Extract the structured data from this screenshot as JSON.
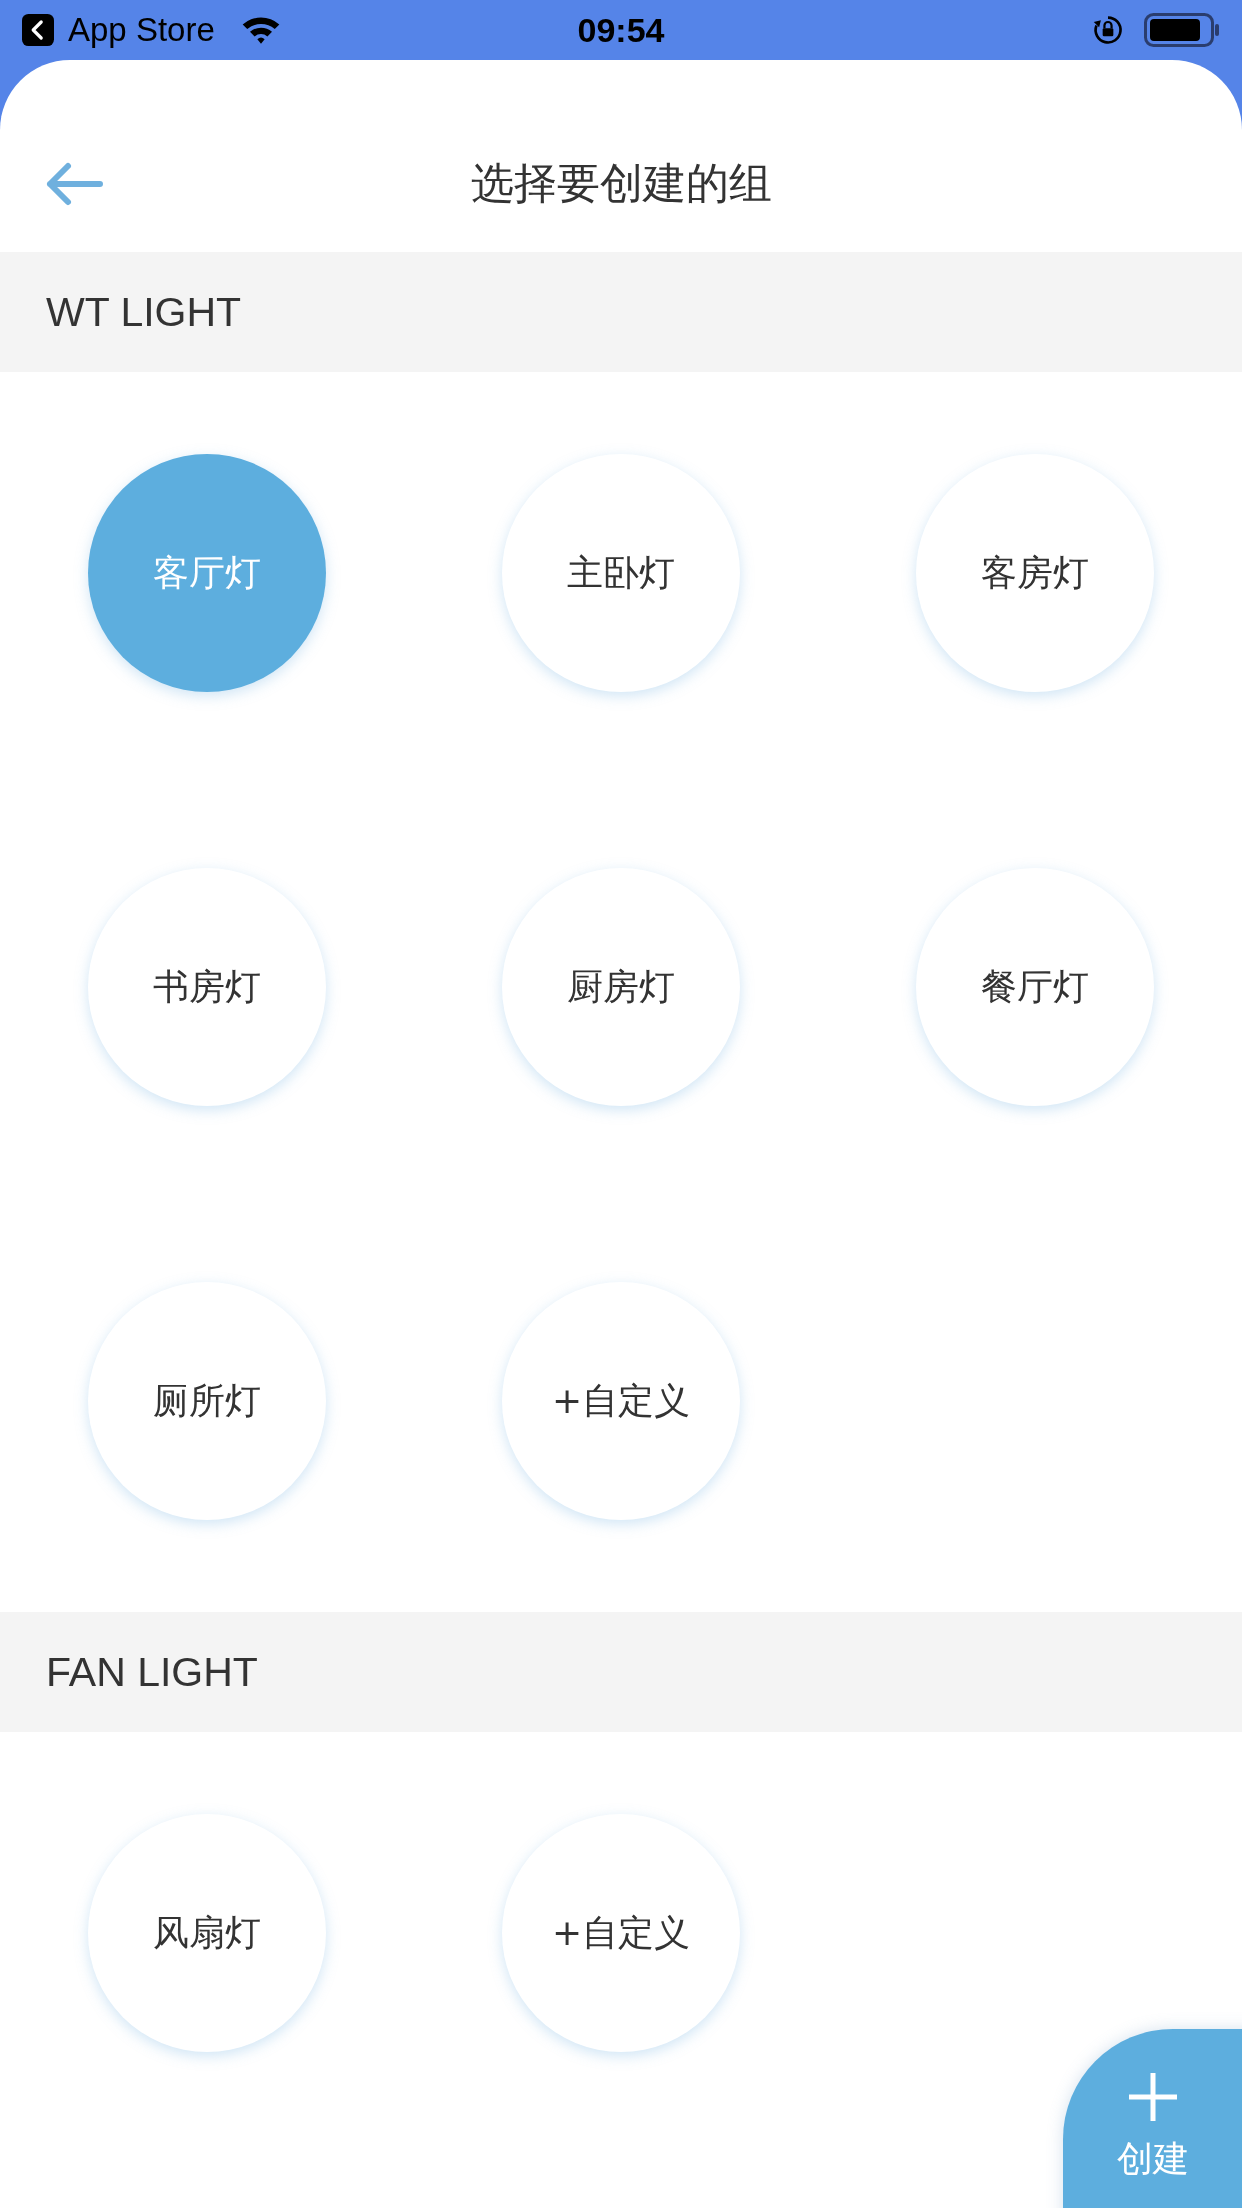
{
  "status_bar": {
    "back_app": "App Store",
    "time": "09:54"
  },
  "header": {
    "title": "选择要创建的组"
  },
  "sections": [
    {
      "title": "WT LIGHT",
      "groups": [
        {
          "label": "客厅灯",
          "selected": true
        },
        {
          "label": "主卧灯",
          "selected": false
        },
        {
          "label": "客房灯",
          "selected": false
        },
        {
          "label": "书房灯",
          "selected": false
        },
        {
          "label": "厨房灯",
          "selected": false
        },
        {
          "label": "餐厅灯",
          "selected": false
        },
        {
          "label": "厕所灯",
          "selected": false
        },
        {
          "label": "+自定义",
          "selected": false
        }
      ]
    },
    {
      "title": "FAN LIGHT",
      "groups": [
        {
          "label": "风扇灯",
          "selected": false
        },
        {
          "label": "+自定义",
          "selected": false
        }
      ]
    }
  ],
  "create_button": {
    "label": "创建"
  }
}
